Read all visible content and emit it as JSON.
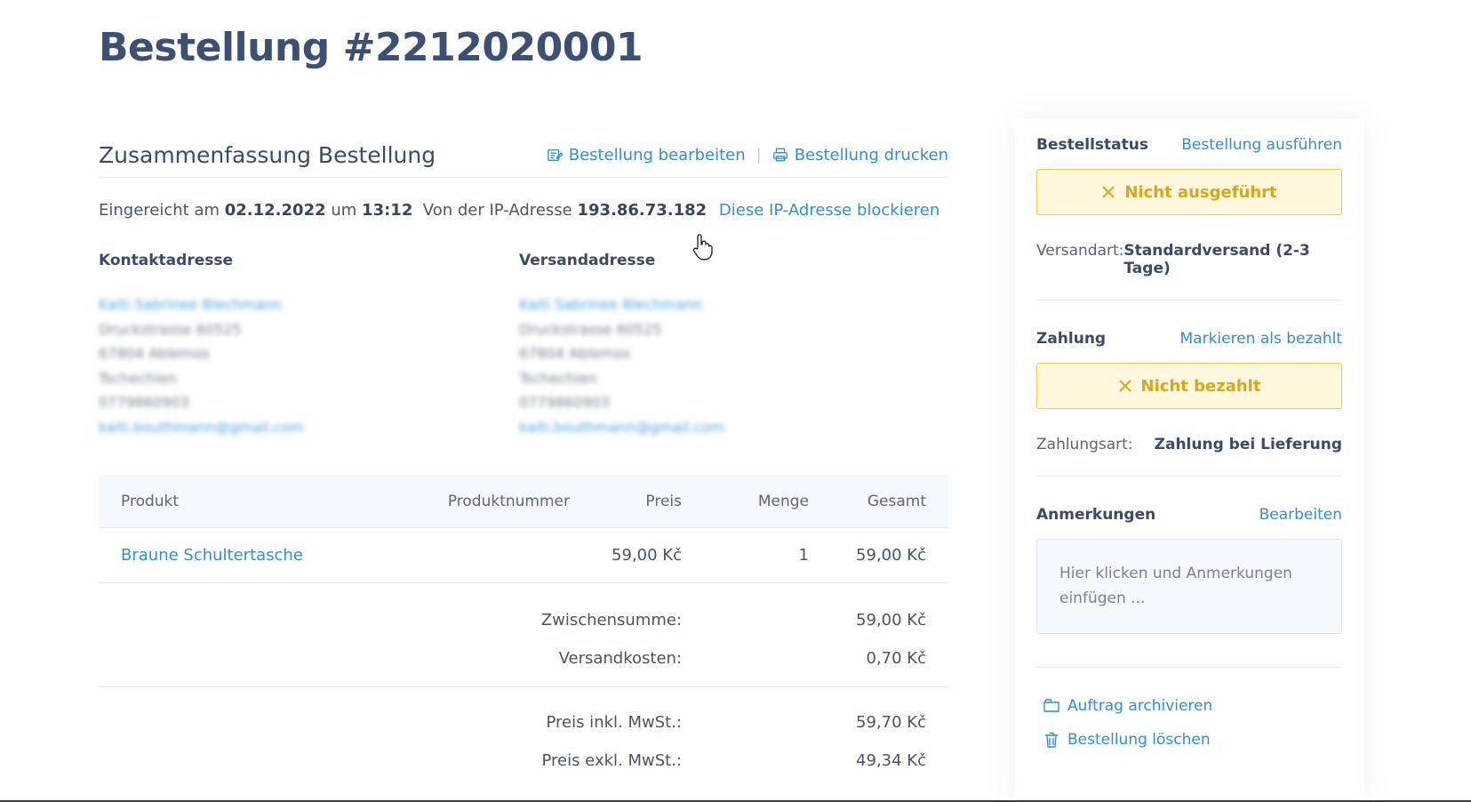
{
  "page": {
    "title": "Bestellung #2212020001"
  },
  "summary": {
    "title": "Zusammenfassung Bestellung",
    "edit_label": "Bestellung bearbeiten",
    "print_label": "Bestellung drucken",
    "sep": "|",
    "submitted_prefix": "Eingereicht am",
    "date": "02.12.2022",
    "time_sep": "um",
    "time": "13:12",
    "ip_prefix": "Von der IP-Adresse",
    "ip": "193.86.73.182",
    "block_ip_label": "Diese IP-Adresse blockieren"
  },
  "contact": {
    "title": "Kontaktadresse",
    "name": "Kaiti Sabrinee Blechmann",
    "street": "Druckstrasse 60525",
    "city": "67804 Ablemos",
    "country": "Tschechien",
    "phone": "0779860903",
    "email": "kaiti.bouthmann@gmail.com"
  },
  "shipping_address": {
    "title": "Versandadresse",
    "name": "Kaiti Sabrinee Blechmann",
    "street": "Druckstrasse 60525",
    "city": "67804 Ablemos",
    "country": "Tschechien",
    "phone": "0779860903",
    "email": "kaiti.bouthmann@gmail.com"
  },
  "table": {
    "headers": {
      "product": "Produkt",
      "number": "Produktnummer",
      "price": "Preis",
      "qty": "Menge",
      "total": "Gesamt"
    },
    "rows": [
      {
        "product": "Braune Schultertasche",
        "number": "",
        "price": "59,00 Kč",
        "qty": "1",
        "total": "59,00 Kč"
      }
    ]
  },
  "totals": {
    "subtotal_label": "Zwischensumme:",
    "subtotal": "59,00 Kč",
    "shipping_label": "Versandkosten:",
    "shipping": "0,70 Kč",
    "incl_label": "Preis inkl. MwSt.:",
    "incl": "59,70 Kč",
    "excl_label": "Preis exkl. MwSt.:",
    "excl": "49,34 Kč"
  },
  "sidebar": {
    "order_status_title": "Bestellstatus",
    "execute_label": "Bestellung ausführen",
    "order_status": "Nicht ausgeführt",
    "shipping_method_label": "Versandart:",
    "shipping_method": "Standardversand (2-3 Tage)",
    "payment_title": "Zahlung",
    "mark_paid_label": "Markieren als bezahlt",
    "payment_status": "Nicht bezahlt",
    "payment_method_label": "Zahlungsart:",
    "payment_method": "Zahlung bei Lieferung",
    "notes_title": "Anmerkungen",
    "notes_edit_label": "Bearbeiten",
    "notes_placeholder": "Hier klicken und Anmerkungen einfügen ...",
    "archive_label": "Auftrag archivieren",
    "delete_label": "Bestellung löschen"
  },
  "colors": {
    "accent": "#2f8fd6",
    "title": "#3c5073",
    "warning_bg": "#fff8dd",
    "warning_border": "#f1c94f",
    "warning_text": "#d6a71a"
  }
}
